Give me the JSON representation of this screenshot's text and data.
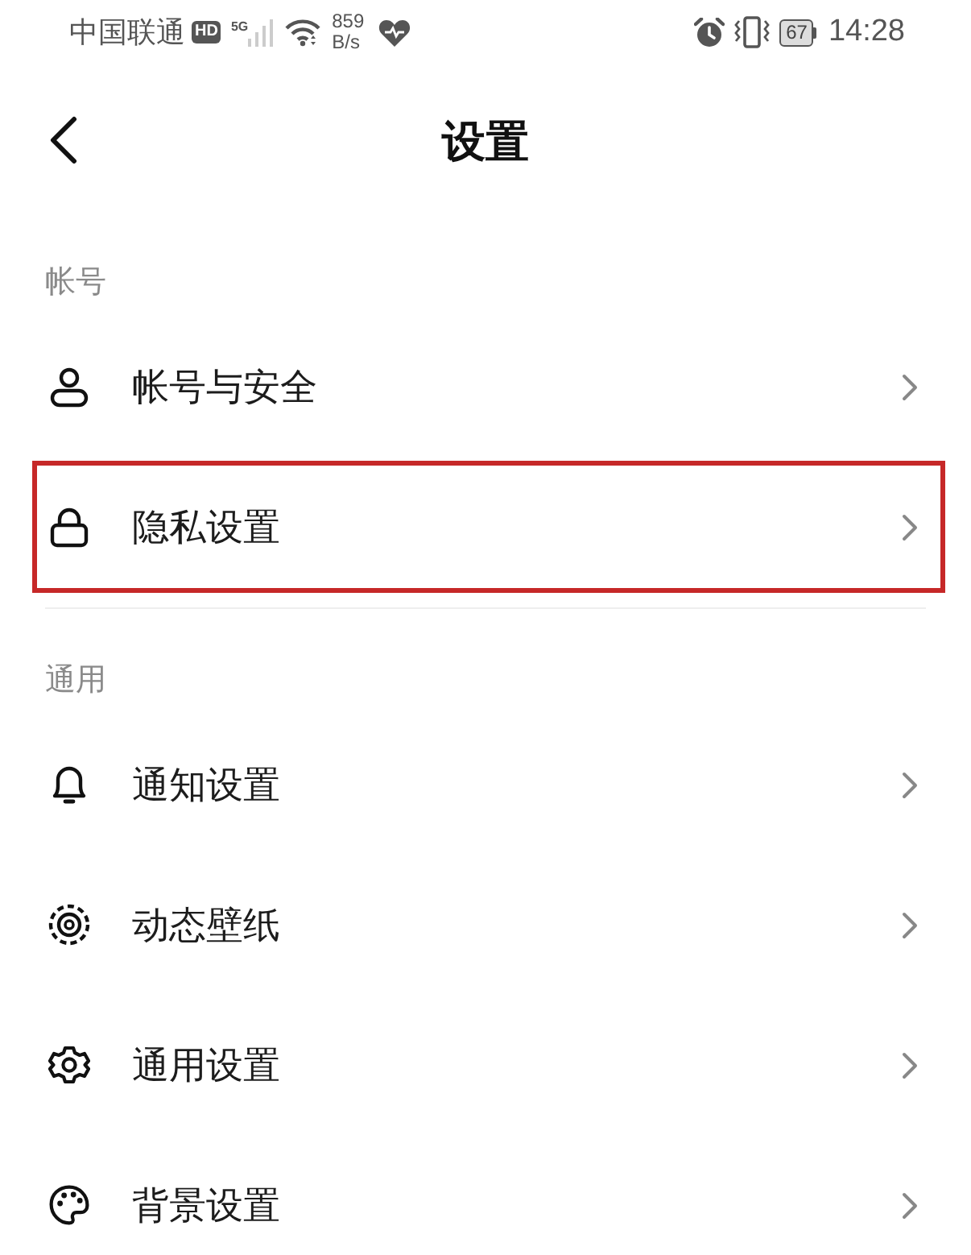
{
  "status_bar": {
    "carrier": "中国联通",
    "hd_badge": "HD",
    "network_type": "5G",
    "speed_value": "859",
    "speed_unit": "B/s",
    "battery": "67",
    "time": "14:28"
  },
  "header": {
    "title": "设置"
  },
  "sections": [
    {
      "title": "帐号",
      "items": [
        {
          "kind": "person",
          "label": "帐号与安全",
          "highlighted": false
        },
        {
          "kind": "lock",
          "label": "隐私设置",
          "highlighted": true
        }
      ]
    },
    {
      "title": "通用",
      "items": [
        {
          "kind": "bell",
          "label": "通知设置",
          "highlighted": false
        },
        {
          "kind": "ring",
          "label": "动态壁纸",
          "highlighted": false
        },
        {
          "kind": "gear",
          "label": "通用设置",
          "highlighted": false
        },
        {
          "kind": "palette",
          "label": "背景设置",
          "highlighted": false
        }
      ]
    }
  ]
}
